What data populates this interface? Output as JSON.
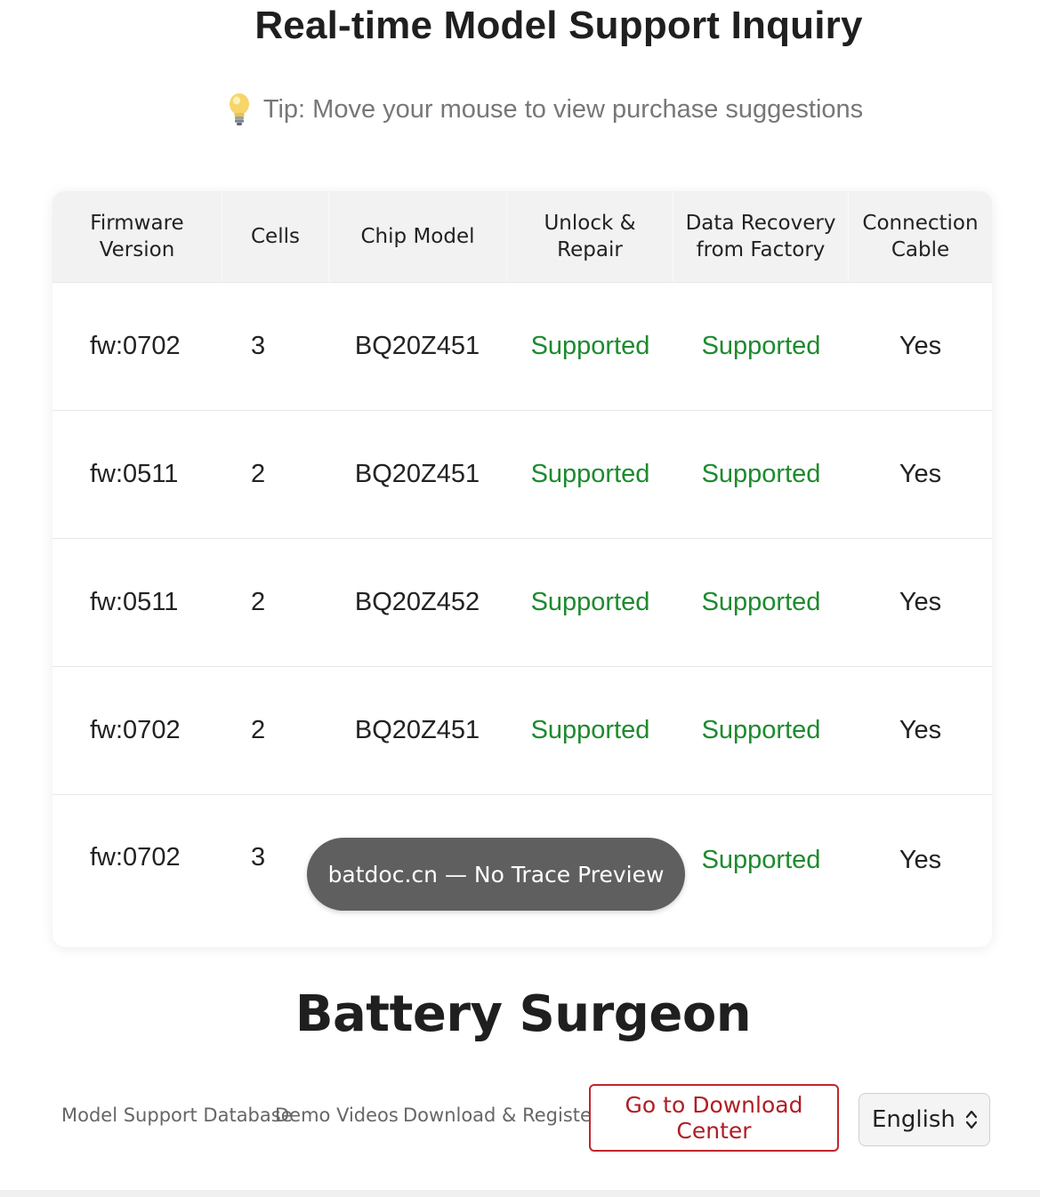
{
  "page": {
    "title": "Real-time Model Support Inquiry",
    "tip": "Tip: Move your mouse to view purchase suggestions",
    "tip_icon": "lightbulb-icon"
  },
  "table": {
    "headers": [
      "Firmware Version",
      "Cells",
      "Chip Model",
      "Unlock & Repair",
      "Data Recovery from Factory",
      "Connection Cable"
    ],
    "rows": [
      {
        "firmware": "fw:0702",
        "cells": "3",
        "chip": "BQ20Z451",
        "unlock": "Supported",
        "recovery": "Supported",
        "cable": "Yes"
      },
      {
        "firmware": "fw:0511",
        "cells": "2",
        "chip": "BQ20Z451",
        "unlock": "Supported",
        "recovery": "Supported",
        "cable": "Yes"
      },
      {
        "firmware": "fw:0511",
        "cells": "2",
        "chip": "BQ20Z452",
        "unlock": "Supported",
        "recovery": "Supported",
        "cable": "Yes"
      },
      {
        "firmware": "fw:0702",
        "cells": "2",
        "chip": "BQ20Z451",
        "unlock": "Supported",
        "recovery": "Supported",
        "cable": "Yes"
      },
      {
        "firmware": "fw:0702",
        "cells": "3",
        "chip": "",
        "unlock": "",
        "recovery": "Supported",
        "cable": "Yes"
      }
    ]
  },
  "toast": {
    "text": "batdoc.cn — No Trace Preview"
  },
  "footer": {
    "brand": "Battery Surgeon",
    "nav": [
      "Model Support Database",
      "Demo Videos",
      "Download & Register"
    ],
    "download_button": "Go to Download Center",
    "language": {
      "selected": "English",
      "icon": "chevron-up-down-icon"
    }
  },
  "colors": {
    "supported": "#1d8a2e",
    "button_border": "#c0262b",
    "toast_bg": "#5f5f5f"
  }
}
